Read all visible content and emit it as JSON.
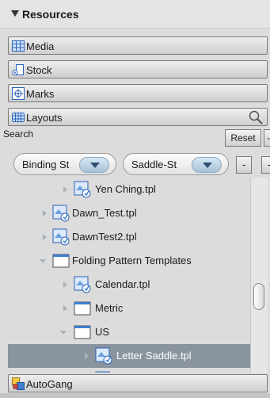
{
  "panel": {
    "title": "Resources"
  },
  "categories": [
    {
      "label": "Media",
      "icon": "grid-icon"
    },
    {
      "label": "Stock",
      "icon": "paper-roll-icon"
    },
    {
      "label": "Marks",
      "icon": "registration-mark-icon"
    },
    {
      "label": "Layouts",
      "icon": "layout-grid-icon"
    }
  ],
  "search": {
    "label": "Search",
    "reset_label": "Reset",
    "minus_label": "-"
  },
  "filters": [
    {
      "value": "Binding St"
    },
    {
      "value": "Saddle-St"
    }
  ],
  "filter_buttons": [
    "-",
    "-"
  ],
  "tree": [
    {
      "name": "Yen Ching.tpl",
      "type": "template",
      "expander": "closed",
      "depth": 2
    },
    {
      "name": "Dawn_Test.tpl",
      "type": "template",
      "expander": "closed",
      "depth": 1
    },
    {
      "name": "DawnTest2.tpl",
      "type": "template",
      "expander": "closed",
      "depth": 1
    },
    {
      "name": "Folding Pattern Templates",
      "type": "folder",
      "expander": "open",
      "depth": 1
    },
    {
      "name": "Calendar.tpl",
      "type": "template",
      "expander": "closed",
      "depth": 2
    },
    {
      "name": "Metric",
      "type": "folder",
      "expander": "closed",
      "depth": 2
    },
    {
      "name": "US",
      "type": "folder",
      "expander": "open",
      "depth": 2
    },
    {
      "name": "Letter Saddle.tpl",
      "type": "template",
      "expander": "closed",
      "depth": 3,
      "selected": true
    },
    {
      "name": "",
      "type": "template",
      "expander": "none",
      "depth": 3
    }
  ],
  "footer": {
    "autogang_label": "AutoGang"
  },
  "colors": {
    "selection": "#8a949e",
    "panel_bg": "#dcdcdc",
    "accent_blue": "#3f7fd0"
  }
}
